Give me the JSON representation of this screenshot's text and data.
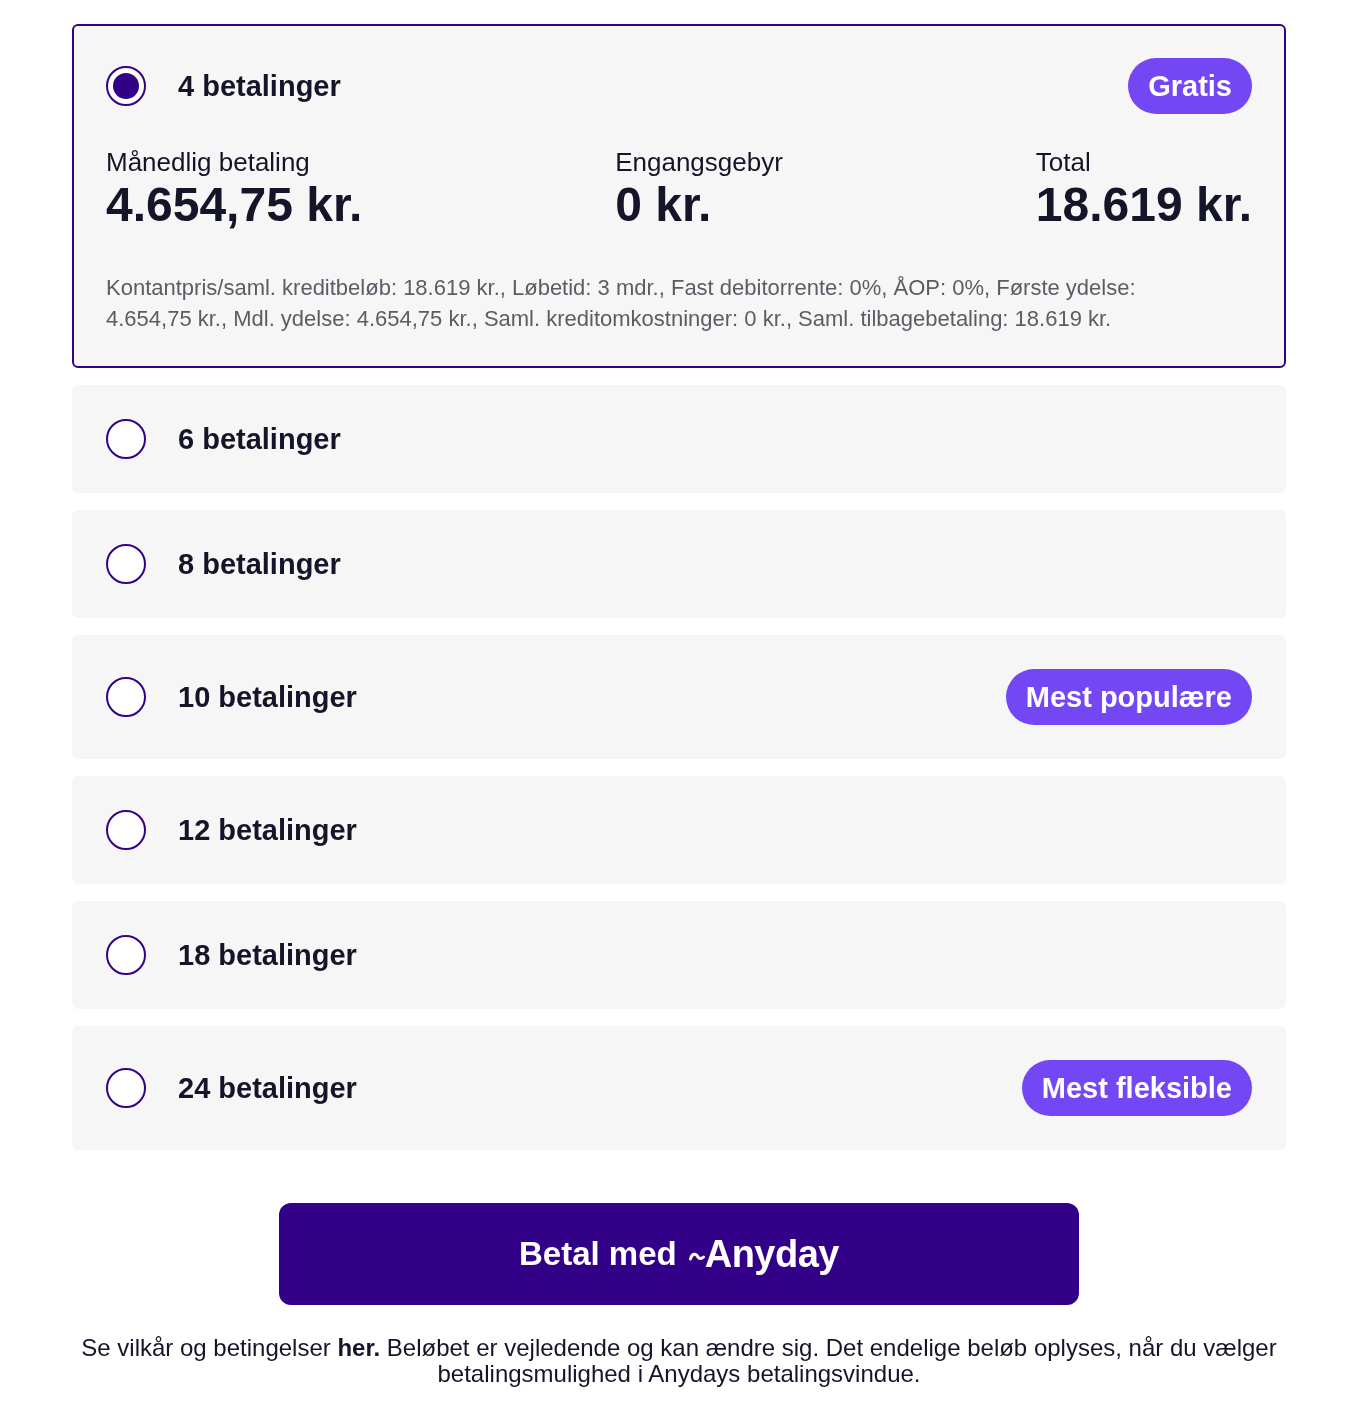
{
  "plans": [
    {
      "label": "4 betalinger",
      "selected": true,
      "badge": "Gratis",
      "summary": {
        "columns": [
          {
            "label": "Månedlig betaling",
            "value": "4.654,75 kr."
          },
          {
            "label": "Engangsgebyr",
            "value": "0 kr."
          },
          {
            "label": "Total",
            "value": "18.619 kr."
          }
        ],
        "terms": "Kontantpris/saml. kreditbeløb: 18.619 kr., Løbetid: 3 mdr., Fast debitorrente: 0%, ÅOP: 0%, Første ydelse: 4.654,75 kr., Mdl. ydelse: 4.654,75 kr., Saml. kreditomkostninger: 0 kr., Saml. tilbagebetaling: 18.619 kr."
      }
    },
    {
      "label": "6 betalinger",
      "selected": false
    },
    {
      "label": "8 betalinger",
      "selected": false
    },
    {
      "label": "10 betalinger",
      "selected": false,
      "badge": "Mest populære"
    },
    {
      "label": "12 betalinger",
      "selected": false
    },
    {
      "label": "18 betalinger",
      "selected": false
    },
    {
      "label": "24 betalinger",
      "selected": false,
      "badge": "Mest fleksible"
    }
  ],
  "pay_button": {
    "label": "Betal med",
    "logo": "Anyday"
  },
  "footer": {
    "before": "Se vilkår og betingelser",
    "link": "her.",
    "after": "Beløbet er vejledende og kan ændre sig. Det endelige beløb oplyses, når du vælger betalingsmulighed i Anydays betalingsvindue."
  }
}
